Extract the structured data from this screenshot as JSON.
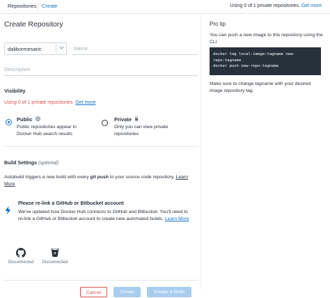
{
  "topbar": {
    "tab_repositories": "Repositories",
    "tab_create": "Create",
    "usage_text": "Using 0 of 1 private repositories.",
    "usage_link": "Get more"
  },
  "form": {
    "title": "Create Repository",
    "namespace_value": "dalibormesaric",
    "name_placeholder": "Name",
    "description_placeholder": "Description",
    "visibility_title": "Visibility",
    "visibility_warning": "Using 0 of 1 private repositories.",
    "visibility_link": "Get more",
    "public_label": "Public",
    "public_desc_1": "Public repositories appear in",
    "public_desc_2": "Docker Hub search results",
    "private_label": "Private",
    "private_desc_1": "Only you can view private",
    "private_desc_2": "repositories",
    "selected_visibility": "Public"
  },
  "build_settings": {
    "title": "Build Settings",
    "optional": "(optional)",
    "text_1": "Autobuild triggers a new build with every",
    "text_bold": "git push",
    "text_2": "to your source code repository.",
    "learn_more": "Learn More",
    "relink_title": "Please re-link a GitHub or Bitbucket account",
    "relink_text": "We've updated how Docker Hub connects to GitHub and Bitbucket. You'll need to re-link a GitHub or Bitbucket account to create new automated builds.",
    "relink_link": "Learn More",
    "providers": [
      {
        "name": "github-icon",
        "status": "Disconnected"
      },
      {
        "name": "bitbucket-icon",
        "status": "Disconnected"
      }
    ]
  },
  "buttons": {
    "cancel": "Cancel",
    "create": "Create",
    "create_build": "Create & Build"
  },
  "pro_tip": {
    "title": "Pro tip",
    "text": "You can push a new image to this repository using the CLI",
    "code_1": "docker tag local-image:tagname new-",
    "code_2": "repo:tagname",
    "code_3": "docker push new-repo:tagname",
    "text2_1": "Make sure to change",
    "text2_em": "tagname",
    "text2_2": "with your desired image repository tag."
  },
  "colors": {
    "accent": "#1173c7",
    "danger": "#d9534f",
    "code_bg": "#27313b",
    "disabled_btn": "#a9cdf0"
  }
}
